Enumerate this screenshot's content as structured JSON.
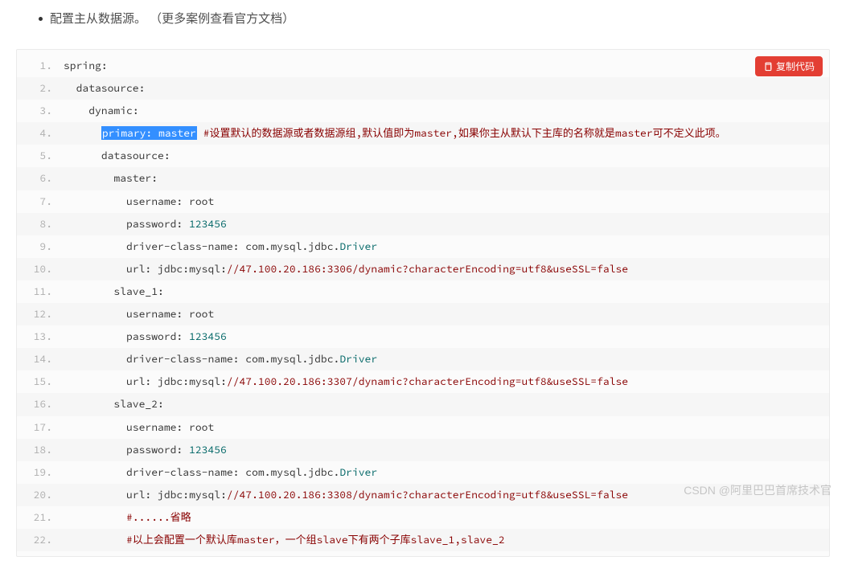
{
  "bullet_text": "配置主从数据源。 （更多案例查看官方文档）",
  "copy_button_label": "复制代码",
  "watermark": "CSDN @阿里巴巴首席技术官",
  "code": {
    "line1": {
      "k": "spring",
      "c": ":"
    },
    "line2": {
      "k": "datasource",
      "c": ":"
    },
    "line3": {
      "k": "dynamic",
      "c": ":"
    },
    "line4": {
      "sel": "primary: master",
      "comment": "#设置默认的数据源或者数据源组,默认值即为master,如果你主从默认下主库的名称就是master可不定义此项。"
    },
    "line5": {
      "k": "datasource",
      "c": ":"
    },
    "line6": {
      "k": "master",
      "c": ":"
    },
    "line7": {
      "k": "username",
      "c": ":",
      "v": " root"
    },
    "line8": {
      "k": "password",
      "c": ":",
      "n": " 123456"
    },
    "line9": {
      "pre": "driver",
      "d1": "-",
      "mid1": "class",
      "d2": "-",
      "mid2": "name",
      "c": ":",
      "a": " com",
      "p1": ".",
      "b": "mysql",
      "p2": ".",
      "cc": "jdbc",
      "p3": ".",
      "dd": "Driver"
    },
    "line10": {
      "k": "url",
      "c": ":",
      "a": " jdbc",
      "p1": ":",
      "b": "mysql",
      "p2": ":",
      "cm": "//47.100.20.186:3306/dynamic?characterEncoding=utf8&useSSL=false"
    },
    "line11": {
      "k": "slave_1",
      "c": ":"
    },
    "line12": {
      "k": "username",
      "c": ":",
      "v": " root"
    },
    "line13": {
      "k": "password",
      "c": ":",
      "n": " 123456"
    },
    "line14": {
      "pre": "driver",
      "d1": "-",
      "mid1": "class",
      "d2": "-",
      "mid2": "name",
      "c": ":",
      "a": " com",
      "p1": ".",
      "b": "mysql",
      "p2": ".",
      "cc": "jdbc",
      "p3": ".",
      "dd": "Driver"
    },
    "line15": {
      "k": "url",
      "c": ":",
      "a": " jdbc",
      "p1": ":",
      "b": "mysql",
      "p2": ":",
      "cm": "//47.100.20.186:3307/dynamic?characterEncoding=utf8&useSSL=false"
    },
    "line16": {
      "k": "slave_2",
      "c": ":"
    },
    "line17": {
      "k": "username",
      "c": ":",
      "v": " root"
    },
    "line18": {
      "k": "password",
      "c": ":",
      "n": " 123456"
    },
    "line19": {
      "pre": "driver",
      "d1": "-",
      "mid1": "class",
      "d2": "-",
      "mid2": "name",
      "c": ":",
      "a": " com",
      "p1": ".",
      "b": "mysql",
      "p2": ".",
      "cc": "jdbc",
      "p3": ".",
      "dd": "Driver"
    },
    "line20": {
      "k": "url",
      "c": ":",
      "a": " jdbc",
      "p1": ":",
      "b": "mysql",
      "p2": ":",
      "cm": "//47.100.20.186:3308/dynamic?characterEncoding=utf8&useSSL=false"
    },
    "line21": {
      "cm": "#......省略"
    },
    "line22": {
      "cm": "#以上会配置一个默认库master，一个组slave下有两个子库slave_1,slave_2"
    }
  }
}
